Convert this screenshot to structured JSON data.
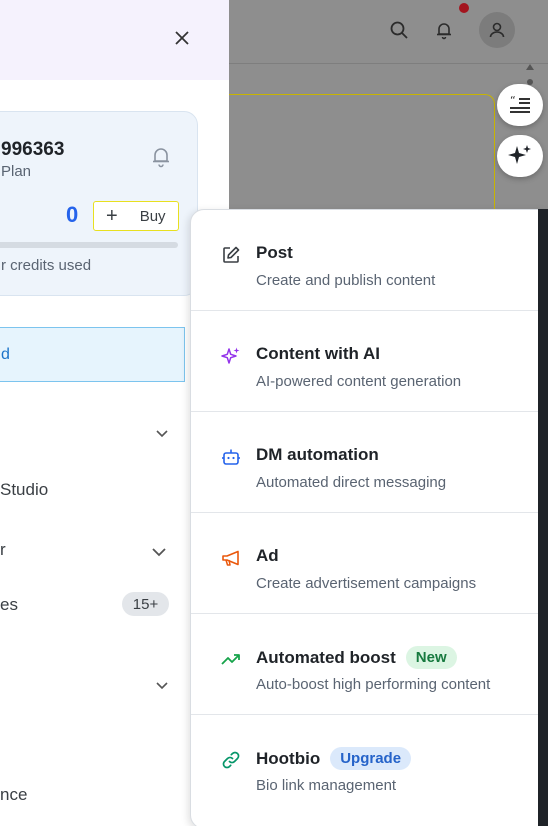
{
  "drawer": {
    "account_id": "996363",
    "plan": "Plan",
    "credit_count": "0",
    "buy_label": "Buy",
    "credits_used": "r credits used",
    "nav_active_label": "d",
    "nav_items": [
      "Studio",
      "r",
      "es",
      "nce"
    ],
    "badge": "15+"
  },
  "menu": {
    "items": [
      {
        "title": "Post",
        "desc": "Create and publish content",
        "icon": "edit-icon"
      },
      {
        "title": "Content with AI",
        "desc": "AI-powered content generation",
        "icon": "sparkle-icon"
      },
      {
        "title": "DM automation",
        "desc": "Automated direct messaging",
        "icon": "robot-icon"
      },
      {
        "title": "Ad",
        "desc": "Create advertisement campaigns",
        "icon": "megaphone-icon"
      },
      {
        "title": "Automated boost",
        "desc": "Auto-boost high performing content",
        "icon": "trending-up-icon",
        "tag": "New"
      },
      {
        "title": "Hootbio",
        "desc": "Bio link management",
        "icon": "link-icon",
        "tag": "Upgrade"
      }
    ]
  },
  "colors": {
    "accent_blue": "#2563eb",
    "ai_purple": "#9333ea",
    "ad_orange": "#ea580c",
    "boost_green": "#16a34a",
    "link_teal": "#059669"
  }
}
